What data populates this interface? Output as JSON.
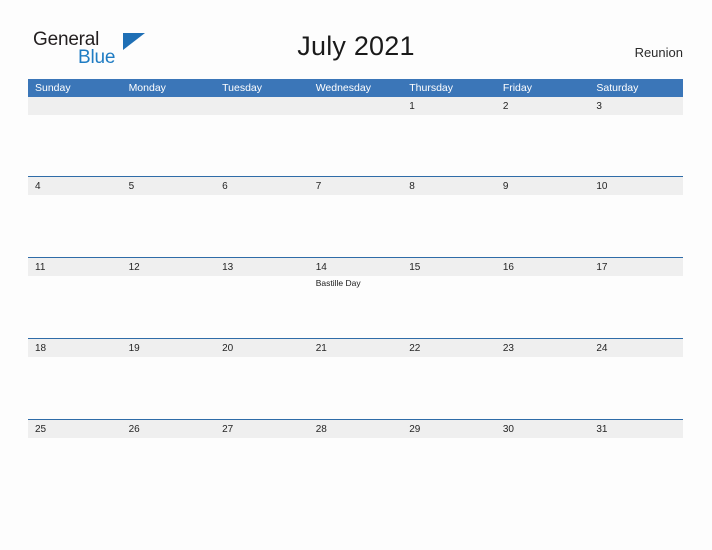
{
  "brand": {
    "name_part1": "General",
    "name_part2": "Blue",
    "triangle_color": "#1f6fb5",
    "blue_text_color": "#1f7cc3"
  },
  "header": {
    "title": "July 2021",
    "region": "Reunion"
  },
  "calendar": {
    "accent_color": "#3b76b8",
    "rule_color": "#2f6ca8",
    "band_color": "#efefef",
    "weekdays": [
      "Sunday",
      "Monday",
      "Tuesday",
      "Wednesday",
      "Thursday",
      "Friday",
      "Saturday"
    ],
    "weeks": [
      {
        "days": [
          {
            "date": "",
            "event": ""
          },
          {
            "date": "",
            "event": ""
          },
          {
            "date": "",
            "event": ""
          },
          {
            "date": "",
            "event": ""
          },
          {
            "date": "1",
            "event": ""
          },
          {
            "date": "2",
            "event": ""
          },
          {
            "date": "3",
            "event": ""
          }
        ]
      },
      {
        "days": [
          {
            "date": "4",
            "event": ""
          },
          {
            "date": "5",
            "event": ""
          },
          {
            "date": "6",
            "event": ""
          },
          {
            "date": "7",
            "event": ""
          },
          {
            "date": "8",
            "event": ""
          },
          {
            "date": "9",
            "event": ""
          },
          {
            "date": "10",
            "event": ""
          }
        ]
      },
      {
        "days": [
          {
            "date": "11",
            "event": ""
          },
          {
            "date": "12",
            "event": ""
          },
          {
            "date": "13",
            "event": ""
          },
          {
            "date": "14",
            "event": "Bastille Day"
          },
          {
            "date": "15",
            "event": ""
          },
          {
            "date": "16",
            "event": ""
          },
          {
            "date": "17",
            "event": ""
          }
        ]
      },
      {
        "days": [
          {
            "date": "18",
            "event": ""
          },
          {
            "date": "19",
            "event": ""
          },
          {
            "date": "20",
            "event": ""
          },
          {
            "date": "21",
            "event": ""
          },
          {
            "date": "22",
            "event": ""
          },
          {
            "date": "23",
            "event": ""
          },
          {
            "date": "24",
            "event": ""
          }
        ]
      },
      {
        "days": [
          {
            "date": "25",
            "event": ""
          },
          {
            "date": "26",
            "event": ""
          },
          {
            "date": "27",
            "event": ""
          },
          {
            "date": "28",
            "event": ""
          },
          {
            "date": "29",
            "event": ""
          },
          {
            "date": "30",
            "event": ""
          },
          {
            "date": "31",
            "event": ""
          }
        ]
      }
    ]
  }
}
